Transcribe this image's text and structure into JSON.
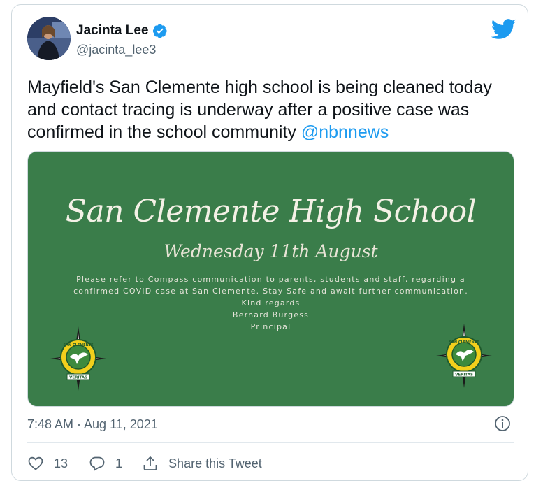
{
  "tweet": {
    "author_name": "Jacinta Lee",
    "author_handle": "@jacinta_lee3",
    "text_before_mention": "Mayfield's San Clemente high school is being cleaned today and contact tracing is underway after a positive case was confirmed in the school community ",
    "mention": "@nbnnews",
    "timestamp": "7:48 AM · Aug 11, 2021",
    "like_count": "13",
    "reply_count": "1",
    "share_label": "Share this Tweet"
  },
  "media": {
    "title": "San Clemente High School",
    "date": "Wednesday 11th August",
    "body_lines": [
      "Please refer to Compass communication to parents, students and staff, regarding a",
      "confirmed COVID case at San Clemente. Stay Safe and await further communication.",
      "Kind regards",
      "Bernard Burgess",
      "Principal"
    ],
    "crest_text": [
      "SAN CLEMENTE",
      "MAYFIELD",
      "VERITAS"
    ],
    "background_color": "#3a7d4a"
  },
  "icons": {
    "verified": "verified-badge-icon",
    "brand": "twitter-bird-icon",
    "info": "info-icon",
    "like": "heart-icon",
    "reply": "reply-icon",
    "share": "share-icon"
  },
  "colors": {
    "accent": "#1d9bf0",
    "text": "#0f1419",
    "secondary": "#536471"
  }
}
